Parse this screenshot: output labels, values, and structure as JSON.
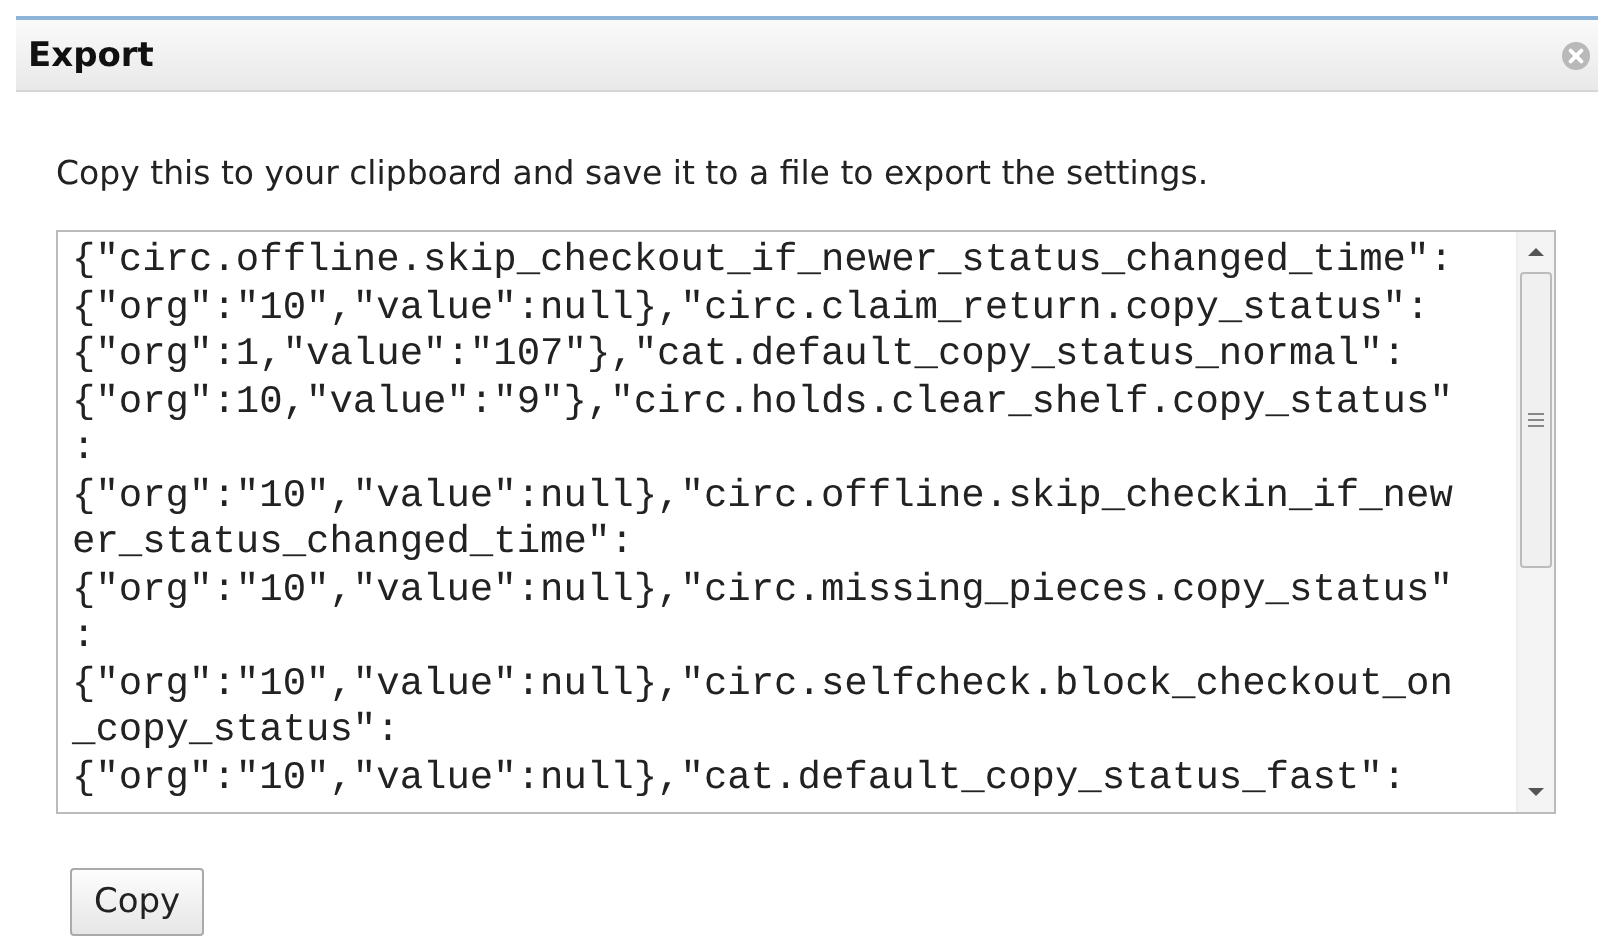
{
  "dialog": {
    "title": "Export",
    "instruction": "Copy this to your clipboard and save it to a file to export the settings.",
    "export_text": {
      "lines": [
        "{\"circ.offline.skip_checkout_if_newer_status_changed_time\":",
        "{\"org\":\"10\",\"value\":null},\"circ.claim_return.copy_status\":",
        "{\"org\":1,\"value\":\"107\"},\"cat.default_copy_status_normal\":",
        "{\"org\":10,\"value\":\"9\"},\"circ.holds.clear_shelf.copy_status\"",
        ":",
        "{\"org\":\"10\",\"value\":null},\"circ.offline.skip_checkin_if_new",
        "er_status_changed_time\":",
        "{\"org\":\"10\",\"value\":null},\"circ.missing_pieces.copy_status\"",
        ":",
        "{\"org\":\"10\",\"value\":null},\"circ.selfcheck.block_checkout_on",
        "_copy_status\":",
        "{\"org\":\"10\",\"value\":null},\"cat.default_copy_status_fast\":"
      ]
    },
    "buttons": [
      "Copy"
    ]
  }
}
